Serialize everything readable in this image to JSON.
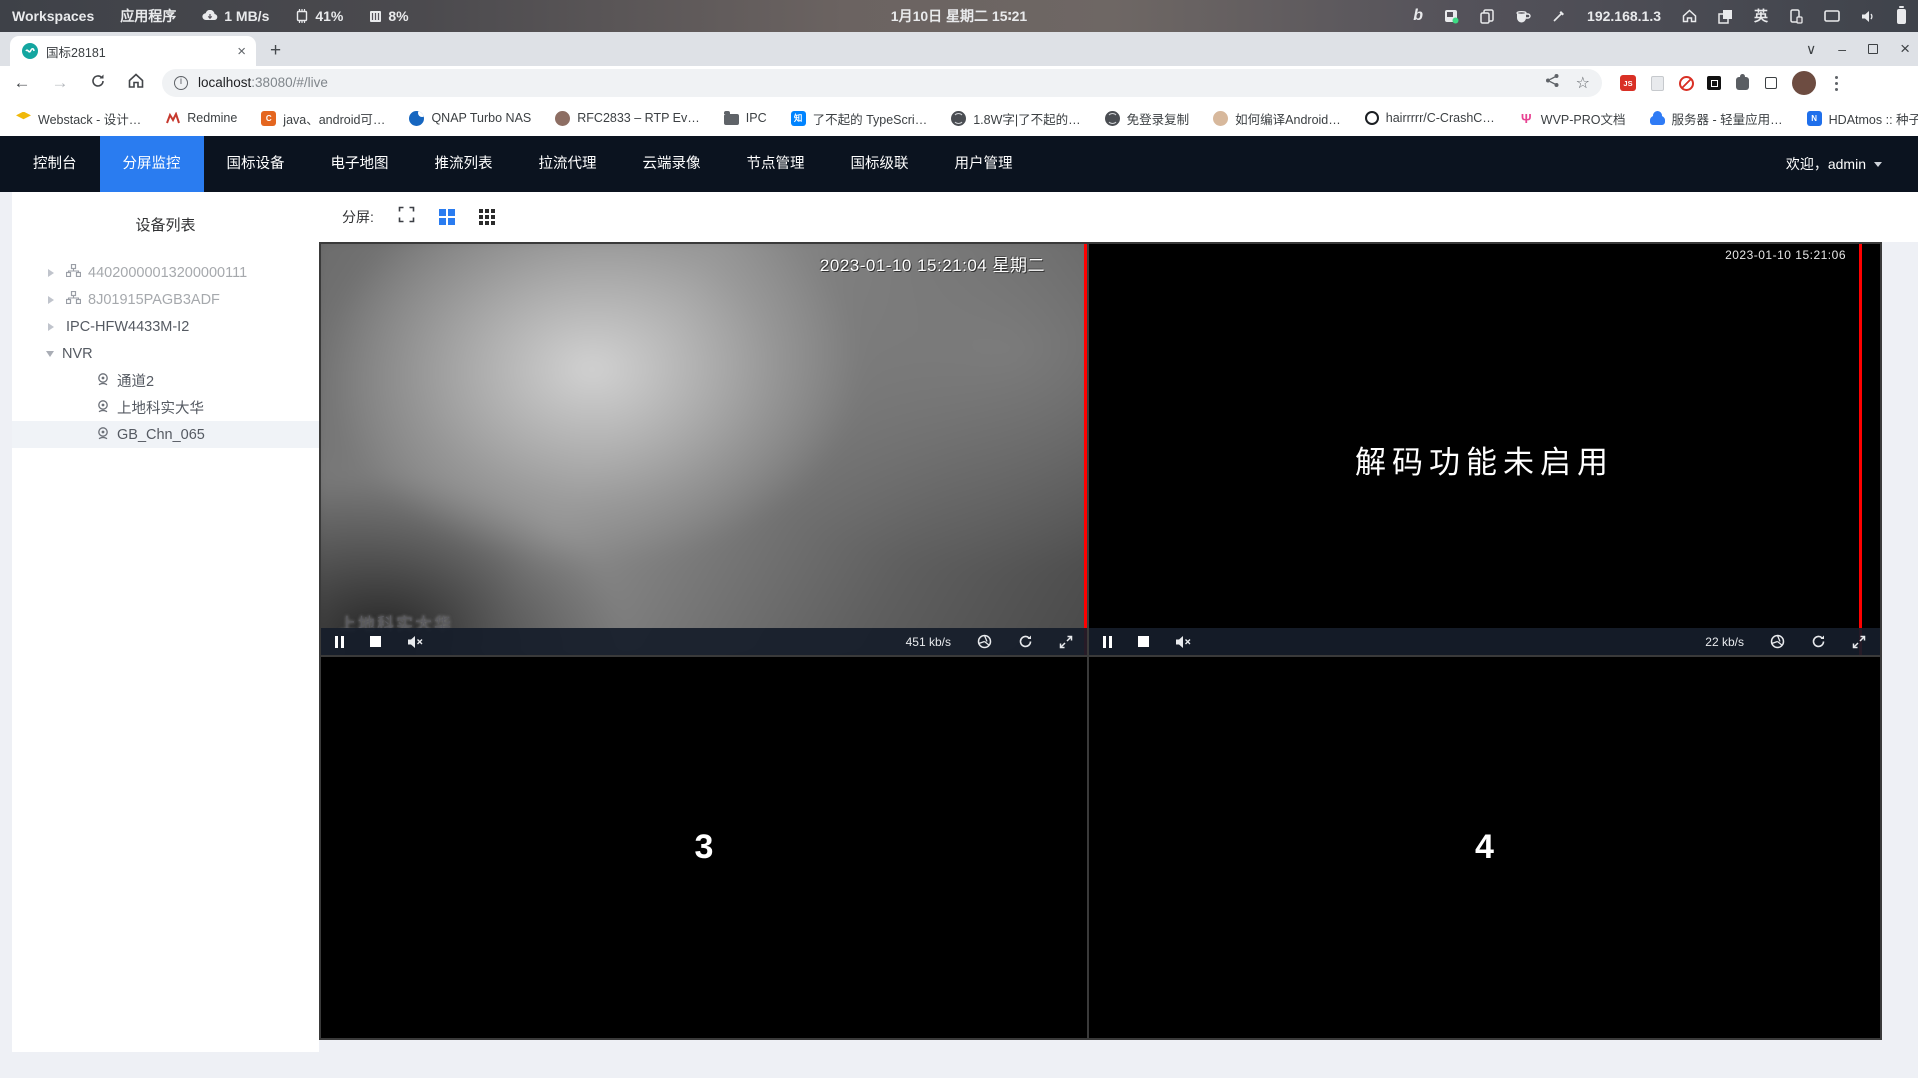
{
  "colors": {
    "accent_blue": "#2a7cf0",
    "nav_bg": "#0b131f",
    "selected_border_red": "#ff0000",
    "content_bg": "#eef0f5",
    "favicon_teal": "#14a6a0"
  },
  "system_bar": {
    "workspaces": "Workspaces",
    "applications": "应用程序",
    "network_speed": "1 MB/s",
    "cpu_usage": "41%",
    "memory_usage": "8%",
    "datetime": "1月10日 星期二 15∶21",
    "bing_glyph": "b",
    "ip_address": "192.168.1.3",
    "input_method": "英"
  },
  "browser": {
    "tab_title": "国标28181",
    "tab_close": "×",
    "new_tab": "+",
    "back": "←",
    "forward": "→",
    "url_host": "localhost",
    "url_rest": ":38080/#/live",
    "js_ext_glyph": "JS",
    "bookmarks": [
      {
        "label": "Webstack - 设计…"
      },
      {
        "label": "Redmine"
      },
      {
        "label": "java、android可…",
        "glyph": "C"
      },
      {
        "label": "QNAP Turbo NAS"
      },
      {
        "label": "RFC2833 – RTP Ev…"
      },
      {
        "label": "IPC"
      },
      {
        "label": "了不起的 TypeScri…",
        "glyph": "知"
      },
      {
        "label": "1.8W字|了不起的…"
      },
      {
        "label": "免登录复制"
      },
      {
        "label": "如何编译Android…"
      },
      {
        "label": "hairrrrr/C-CrashC…"
      },
      {
        "label": "WVP-PRO文档",
        "glyph": "Ψ"
      },
      {
        "label": "服务器 - 轻量应用…"
      },
      {
        "label": "HDAtmos :: 种子 *…"
      }
    ],
    "bookmarks_overflow": "»"
  },
  "app": {
    "nav_tabs": [
      {
        "label": "控制台"
      },
      {
        "label": "分屏监控"
      },
      {
        "label": "国标设备"
      },
      {
        "label": "电子地图"
      },
      {
        "label": "推流列表"
      },
      {
        "label": "拉流代理"
      },
      {
        "label": "云端录像"
      },
      {
        "label": "节点管理"
      },
      {
        "label": "国标级联"
      },
      {
        "label": "用户管理"
      }
    ],
    "welcome": "欢迎，admin",
    "sidebar": {
      "title": "设备列表",
      "tree": [
        {
          "label": "44020000013200000111"
        },
        {
          "label": "8J01915PAGB3ADF"
        },
        {
          "label": "IPC-HFW4433M-I2"
        },
        {
          "label": "NVR"
        },
        {
          "label": "通道2"
        },
        {
          "label": "上地科实大华"
        },
        {
          "label": "GB_Chn_065"
        }
      ]
    },
    "toolbar": {
      "split_label": "分屏:"
    },
    "videos": {
      "v1": {
        "timestamp": "2023-01-10 15:21:04 星期二",
        "bitrate": "451 kb/s",
        "watermark": "上地科实大华"
      },
      "v2": {
        "timestamp": "2023-01-10 15:21:06",
        "bitrate": "22 kb/s",
        "message": "解码功能未启用"
      },
      "v3": {
        "label": "3"
      },
      "v4": {
        "label": "4"
      }
    }
  }
}
